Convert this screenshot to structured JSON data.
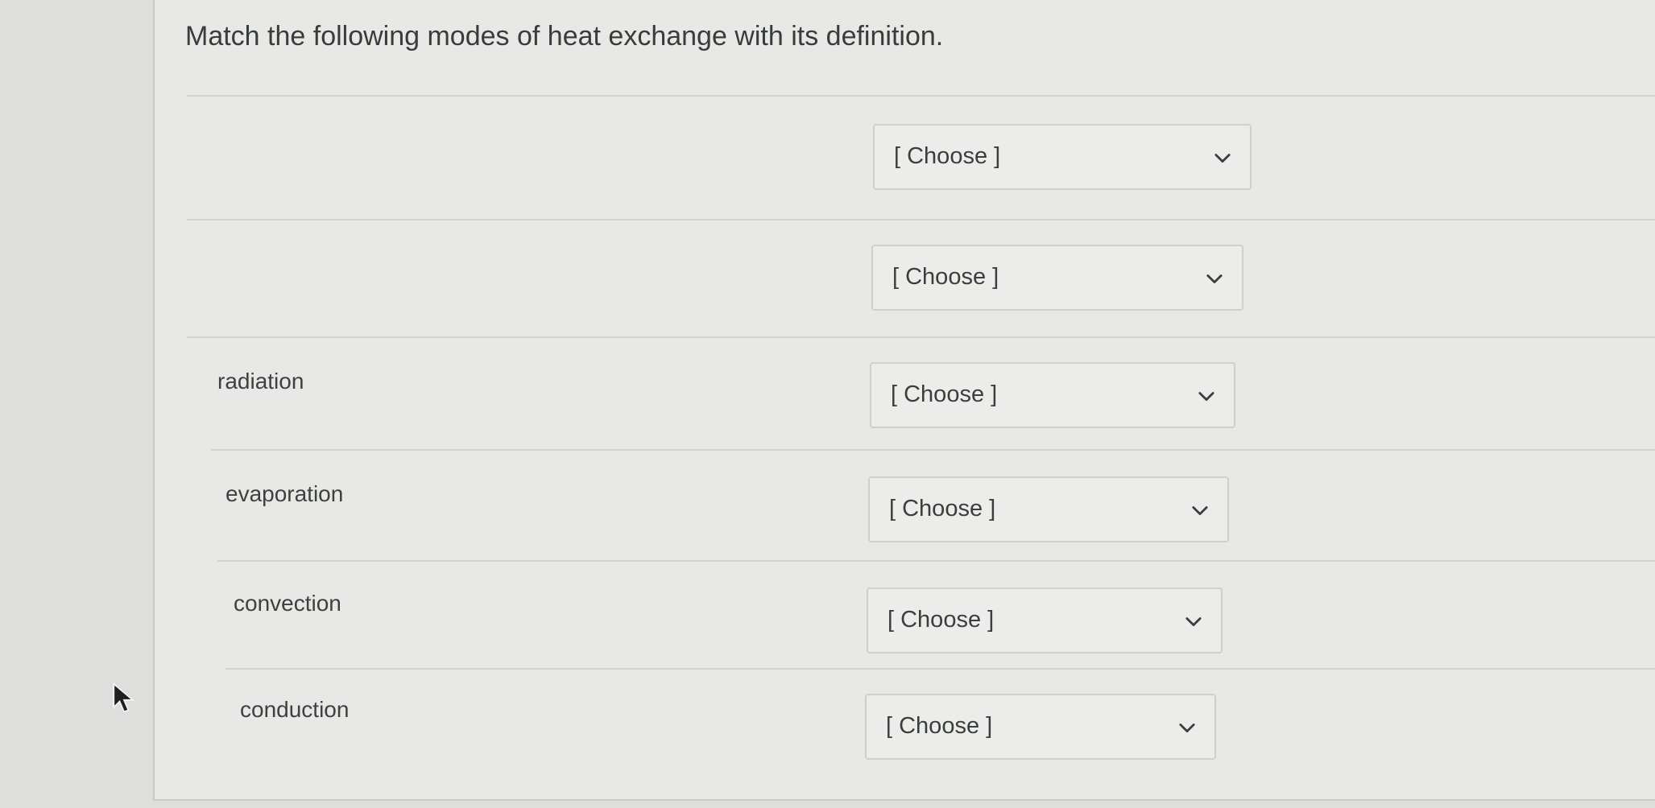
{
  "question": {
    "title": "Match the following modes of heat exchange with its definition."
  },
  "rows": [
    {
      "label": "",
      "select": {
        "value": "[ Choose ]"
      }
    },
    {
      "label": "",
      "select": {
        "value": "[ Choose ]"
      }
    },
    {
      "label": "radiation",
      "select": {
        "value": "[ Choose ]"
      }
    },
    {
      "label": "evaporation",
      "select": {
        "value": "[ Choose ]"
      }
    },
    {
      "label": "convection",
      "select": {
        "value": "[ Choose ]"
      }
    },
    {
      "label": "conduction",
      "select": {
        "value": "[ Choose ]"
      }
    }
  ],
  "icons": {
    "dropdown": "chevron-down-icon",
    "cursor": "mouse-pointer-icon"
  },
  "colors": {
    "background": "#dedfdd",
    "card": "#e8e8e6",
    "text": "#3c3d3e",
    "border": "#cfd0ce"
  }
}
